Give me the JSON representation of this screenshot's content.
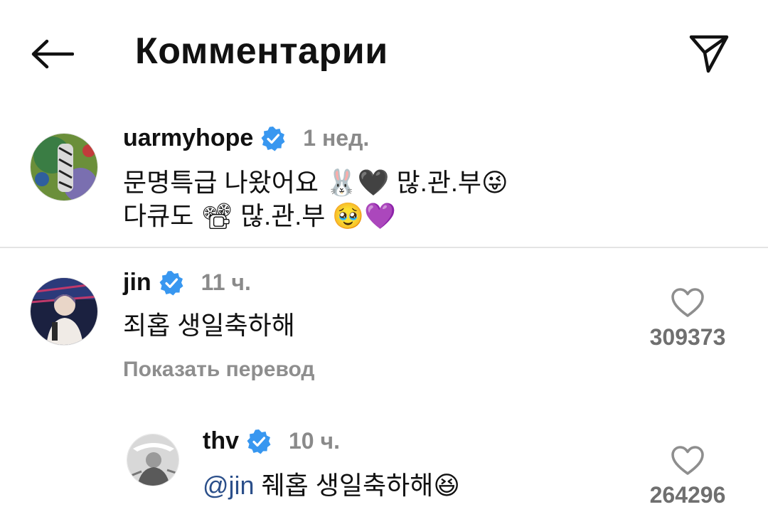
{
  "header": {
    "title": "Комментарии",
    "back_icon": "arrow-left-icon",
    "send_icon": "paper-plane-icon"
  },
  "caption": {
    "username": "uarmyhope",
    "verified": true,
    "time": "1 нед.",
    "line1": "문명특급 나왔어요 🐰🖤 많.관.부😜",
    "line2": "다큐도 📽 많.관.부 🥹💜"
  },
  "comments": [
    {
      "username": "jin",
      "verified": true,
      "time": "11 ч.",
      "text": "죄홉 생일축하해",
      "translate": "Показать перевод",
      "likes": "309373"
    },
    {
      "username": "thv",
      "verified": true,
      "time": "10 ч.",
      "mention": "@jin",
      "text": " 줴홉 생일축하해😆",
      "likes": "264296"
    }
  ],
  "colors": {
    "verified_blue": "#3897f0",
    "mention": "#2b4f8a",
    "muted": "#8a8a8a"
  }
}
